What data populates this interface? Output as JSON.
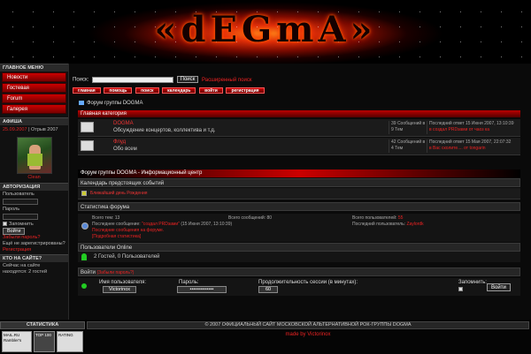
{
  "banner": {
    "logo_text": "«dEGmA»"
  },
  "left": {
    "main_menu_title": "ГЛАВНОЕ МЕНЮ",
    "menu_items": [
      "Новости",
      "Гостевая",
      "Forum",
      "Галерея"
    ],
    "afisha_title": "АФИША",
    "afisha_date": "25.09.2007",
    "afisha_text": "| Отрыв 2007",
    "photo_caption": "Clean",
    "auth_title": "АВТОРИЗАЦИЯ",
    "user_label": "Пользователь",
    "password_label": "Пароль",
    "remember_label": "Запомнить",
    "login_btn": "Войти",
    "forgot_link": "Забыли пароль?",
    "not_registered": "Ещё не зарегистрированы?",
    "register_link": "Регистрация",
    "who_title": "КТО НА САЙТЕ?",
    "who_text": "Сейчас на сайте находятся: 2 гостей"
  },
  "main": {
    "search_label": "Поиск:",
    "search_btn": "Поиск",
    "adv_search": "Расширенный поиск",
    "nav": [
      "главная",
      "помощь",
      "поиск",
      "календарь",
      "войти",
      "регистрация"
    ],
    "forum_title": "Форум группы DOGMA",
    "main_category": "Главная категория",
    "forums": [
      {
        "name": "DOGMA",
        "desc": "Обсуждение концертов, коллектива и т.д.",
        "stat1": "39 Сообщений в",
        "stat2": "9 Тем",
        "last1": "Последний ответ 15 Июня 2007, 13:10:39",
        "last2": "в создал PRDзами от чаоз ка"
      },
      {
        "name": "Флуд",
        "desc": "Обо всем",
        "stat1": "42 Сообщений в",
        "stat2": "4 Тем",
        "last1": "Последний ответ 15 Мая 2007, 22:07:32",
        "last2": "в Вас сколите.... от tongarin"
      }
    ],
    "info_title": "Форум группы DOGMA - Информационный центр",
    "calendar_title": "Календарь предстоящих событий",
    "calendar_item": "Ближайший день Рождения",
    "stats_title": "Статистика форума",
    "stats": {
      "topics_label": "Всего тем:",
      "topics": "13",
      "posts_label": "Всего сообщений:",
      "posts": "80",
      "users_label": "Всего пользователей:",
      "users": "55",
      "last_post_label": "Последнее сообщение:",
      "last_post": "\"создал PRDзами\"",
      "last_post_date": "(15 Июня 2007, 13:10:39)",
      "latest_member_label": "Последний пользователь:",
      "latest_member": "Zaylordk",
      "recent_posts": "Последние сообщения на форуме.",
      "more_stats": "[Подробная статистика]"
    },
    "online_title": "Пользователи Online",
    "online_text": "2 Гостей, 0 Пользователей",
    "login_title": "Войти",
    "forgot": "(Забыли пароль?)",
    "username_label": "Имя пользователя:",
    "username_value": "Victorinox",
    "password_label": "Пароль:",
    "password_value": "••••••••••••••",
    "session_label": "Продолжительность сессии (в минутах):",
    "session_value": "60",
    "remember_label": "Запомнить:",
    "login_btn": "Войти"
  },
  "footer": {
    "stats_title": "СТАТИСТИКА",
    "copyright": "© 2007 ОФИЦИАЛЬНЫЙ САЙТ МОСКОВСКОЙ АЛЬТЕРНАТИВНОЙ РОК-ГРУППЫ DOGMA",
    "made_by": "made by Victorinox",
    "counter1": "MAIL.RU Rambler's",
    "counter2": "TOP 100",
    "counter3": "RATING"
  }
}
